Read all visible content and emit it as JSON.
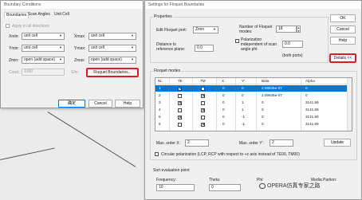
{
  "bc_dialog": {
    "title": "Boundary Conditions",
    "tabs": [
      "Boundaries",
      "Scan Angles",
      "Unit Cell"
    ],
    "apply_all_label": "Apply in all directions",
    "xmin_label": "Xmin:",
    "xmin_value": "unit cell",
    "xmax_label": "Xmax:",
    "xmax_value": "unit cell",
    "ymin_label": "Ymin:",
    "ymin_value": "unit cell",
    "ymax_label": "Ymax:",
    "ymax_value": "unit cell",
    "zmin_label": "Zmin:",
    "zmin_value": "open (add space)",
    "zmax_label": "Zmax:",
    "zmax_value": "open (add space)",
    "cond_label": "Cond.:",
    "cond_value": "1000",
    "unit_label": "S/m",
    "floquet_button": "Floquet Boundaries...",
    "ok_button": "确定",
    "cancel_button": "Cancel",
    "help_button": "Help"
  },
  "fb_dialog": {
    "title": "Settings for Floquet Boundaries",
    "properties_label": "Properties",
    "edit_port_label": "Edit Floquet port:",
    "edit_port_value": "Zmin",
    "num_modes_label": "Number of Floquet modes:",
    "num_modes_value": "18",
    "distance_label": "Distance to reference plane:",
    "distance_value": "0.0",
    "polarization_label": "Polarization independent of scan angle phi:",
    "polarization_value": "0.0",
    "both_ports_label": "(both ports)",
    "ok_button": "OK",
    "cancel_button": "Cancel",
    "help_button": "Help",
    "details_button": "Details <<",
    "modes_label": "Floquet modes",
    "columns": [
      "Nr.",
      "TE",
      "TM",
      "X",
      "Y'",
      "Beta",
      "Alpha"
    ],
    "rows": [
      {
        "nr": "1",
        "te": true,
        "tm": false,
        "x": "0",
        "y": "0",
        "beta": "2.09645e-07",
        "alpha": "0"
      },
      {
        "nr": "2",
        "te": false,
        "tm": true,
        "x": "0",
        "y": "0",
        "beta": "2.09645e-07",
        "alpha": "0"
      },
      {
        "nr": "3",
        "te": true,
        "tm": false,
        "x": "0",
        "y": "1",
        "beta": "0",
        "alpha": "3141.59"
      },
      {
        "nr": "4",
        "te": false,
        "tm": true,
        "x": "0",
        "y": "1",
        "beta": "0",
        "alpha": "3141.59"
      },
      {
        "nr": "5",
        "te": true,
        "tm": false,
        "x": "0",
        "y": "-1",
        "beta": "0",
        "alpha": "3141.59"
      },
      {
        "nr": "6",
        "te": false,
        "tm": true,
        "x": "0",
        "y": "-1",
        "beta": "0",
        "alpha": "3141.59"
      }
    ],
    "max_x_label": "Max. order X:",
    "max_x_value": "2",
    "max_y_label": "Max. order Y':",
    "max_y_value": "2",
    "update_button": "Update",
    "circular_label": "Circular polarization (LCP, RCP with respect to +z axis instead of TE00, TM00)",
    "sort_label": "Sort evaluation point",
    "frequency_label": "Frequency:",
    "frequency_value": "10",
    "theta_label": "Theta:",
    "theta_value": "0",
    "phi_label": "Phi:",
    "media_label": "Media Partion:"
  },
  "watermark": "OPERA仿真专家之路"
}
